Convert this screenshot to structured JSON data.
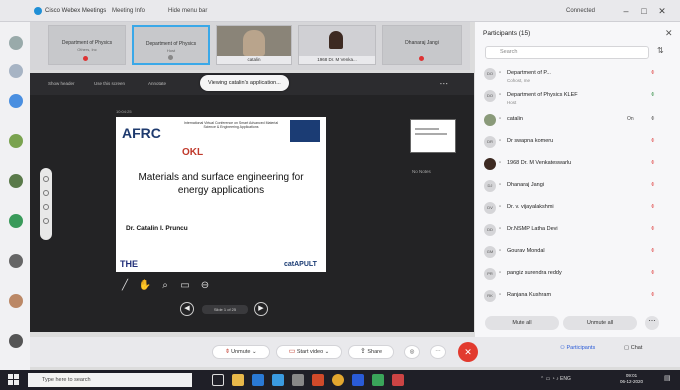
{
  "titlebar": {
    "app_title": "Cisco Webex Meetings",
    "menu_meeting_info": "Meeting Info",
    "menu_hide_bar": "Hide menu bar",
    "connected": "Connected"
  },
  "video_strip": {
    "tiles": [
      {
        "name": "Department of Physics",
        "sub": "Others, Inc"
      },
      {
        "name": "Department of Physics",
        "sub": "Host"
      },
      {
        "name": "",
        "sub": "",
        "caption": "catalin"
      },
      {
        "name": "",
        "sub": "",
        "caption": "1968 Dr. M Venka..."
      },
      {
        "name": "Dhanaraj Jangi",
        "sub": ""
      }
    ]
  },
  "share": {
    "toolbar_labels": [
      "Show header",
      "Use this screen",
      "Annotate"
    ],
    "viewing_badge": "Viewing catalin's application...",
    "slide_time": "10:04:25",
    "no_notes": "No Notes"
  },
  "slide": {
    "logo_afrc": "AFRC",
    "conference": "International Virtual Conference on Smart Advanced Material Science & Engineering Applications",
    "logo_okl": "OKL",
    "title": "Materials and surface engineering for energy applications",
    "author": "Dr. Catalin I. Pruncu",
    "logo_the": "THE",
    "logo_catapult": "catAPULT"
  },
  "pager": {
    "info": "Slide 1 of 25"
  },
  "participants": {
    "header": "Participants (15)",
    "search_placeholder": "Search",
    "rows": [
      {
        "initials": "DO",
        "name": "Department of P...",
        "sub": "Cohost, me",
        "status": "mic-off"
      },
      {
        "initials": "DO",
        "name": "Department of Physics KLEF",
        "sub": "Host",
        "status": "mic-on"
      },
      {
        "initials": "",
        "name": "catalin",
        "sub": "",
        "status": "presenting",
        "extra": "On"
      },
      {
        "initials": "DR",
        "name": "Dr swapna komeru",
        "sub": "",
        "status": "mic-off"
      },
      {
        "initials": "",
        "name": "1968 Dr. M Venkateswarlu",
        "sub": "",
        "status": "mic-off"
      },
      {
        "initials": "DJ",
        "name": "Dhanaraj Jangi",
        "sub": "",
        "status": "mic-off"
      },
      {
        "initials": "DV",
        "name": "Dr. v. vijayalakshmi",
        "sub": "",
        "status": "mic-off"
      },
      {
        "initials": "DD",
        "name": "Dr.NSMP Latha Devi",
        "sub": "",
        "status": "mic-off"
      },
      {
        "initials": "GM",
        "name": "Gourav Mondal",
        "sub": "",
        "status": "mic-off"
      },
      {
        "initials": "PR",
        "name": "pangiz surendra reddy",
        "sub": "",
        "status": "mic-off"
      },
      {
        "initials": "RK",
        "name": "Ranjana Kushram",
        "sub": "",
        "status": "mic-off"
      }
    ],
    "mute_all": "Mute all",
    "unmute_all": "Unmute all"
  },
  "controls": {
    "unmute": "Unmute",
    "start_video": "Start video",
    "share": "Share",
    "participants": "Participants",
    "chat": "Chat"
  },
  "taskbar": {
    "search_placeholder": "Type here to search",
    "language": "ENG",
    "time": "09:01",
    "date": "06-12-2020"
  }
}
